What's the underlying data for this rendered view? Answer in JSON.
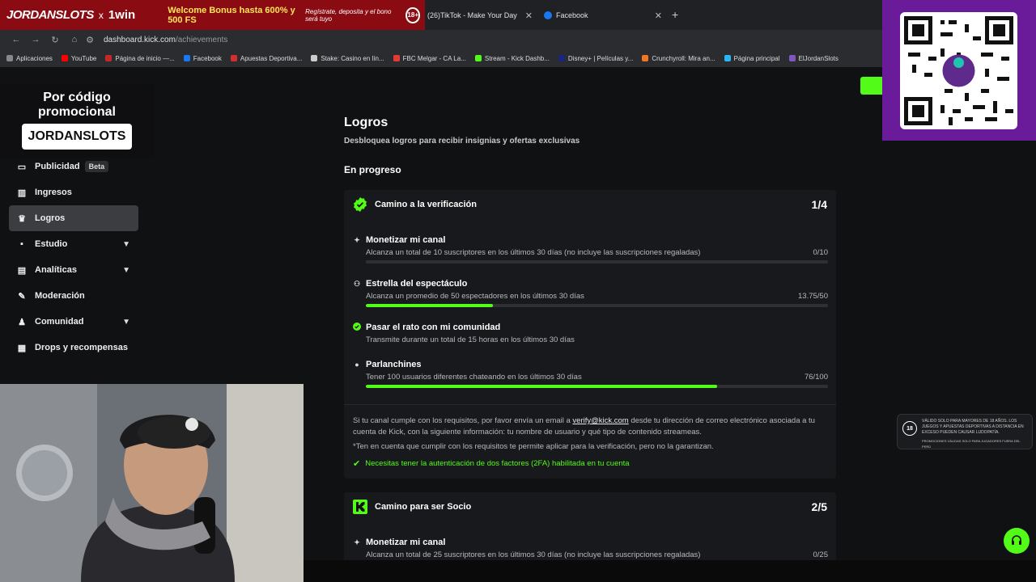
{
  "banner": {
    "brand": "JORDANSLOTS",
    "x": "x",
    "partner": "1win",
    "bonus": "Welcome Bonus hasta 600% y 500 FS",
    "register": "Regístrate, deposita y el bono será tuyo",
    "age": "18+"
  },
  "tabs": [
    {
      "label": "(26)TikTok - Make Your Day"
    },
    {
      "label": "Facebook"
    }
  ],
  "address": {
    "domain": "dashboard.kick.com",
    "path": "/achievements"
  },
  "bookmarks": [
    {
      "label": "Aplicaciones",
      "color": "#888888"
    },
    {
      "label": "YouTube",
      "color": "#ff0000"
    },
    {
      "label": "Página de inicio —...",
      "color": "#c62828"
    },
    {
      "label": "Facebook",
      "color": "#1877f2"
    },
    {
      "label": "Apuestas Deportiva...",
      "color": "#d32f2f"
    },
    {
      "label": "Stake: Casino en lín...",
      "color": "#cccccc"
    },
    {
      "label": "FBC Melgar - CA La...",
      "color": "#e53935"
    },
    {
      "label": "Stream - Kick Dashb...",
      "color": "#53fc18"
    },
    {
      "label": "Disney+ | Películas y...",
      "color": "#1a237e"
    },
    {
      "label": "Crunchyroll: Mira an...",
      "color": "#f47521"
    },
    {
      "label": "Página principal",
      "color": "#29b6f6"
    },
    {
      "label": "ElJordanSlots",
      "color": "#7e57c2"
    }
  ],
  "promo": {
    "line1": "Por código",
    "line2": "promocional",
    "code": "JORDANSLOTS"
  },
  "sidebar": {
    "items": [
      {
        "label": "Publicidad",
        "badge": "Beta"
      },
      {
        "label": "Ingresos"
      },
      {
        "label": "Logros"
      },
      {
        "label": "Estudio"
      },
      {
        "label": "Analíticas"
      },
      {
        "label": "Moderación"
      },
      {
        "label": "Comunidad"
      },
      {
        "label": "Drops y recompensas"
      }
    ]
  },
  "main": {
    "title": "Logros",
    "subtitle": "Desbloquea logros para recibir insignias y ofertas exclusivas",
    "section": "En progreso",
    "card1": {
      "title": "Camino a la verificación",
      "progress": "1/4",
      "tasks": [
        {
          "title": "Monetizar mi canal",
          "desc": "Alcanza un total de 10 suscriptores en los últimos 30 días (no incluye las suscripciones regaladas)",
          "value": "0/10",
          "fill": 0
        },
        {
          "title": "Estrella del espectáculo",
          "desc": "Alcanza un promedio de 50 espectadores en los últimos 30 días",
          "value": "13.75/50",
          "fill": 0.275
        },
        {
          "title": "Pasar el rato con mi comunidad",
          "desc": "Transmite durante un total de 15 horas en los últimos 30 días",
          "value": "",
          "fill": null
        },
        {
          "title": "Parlanchines",
          "desc": "Tener 100 usuarios diferentes chateando en los últimos 30 días",
          "value": "76/100",
          "fill": 0.76
        }
      ],
      "note_prefix": "Si tu canal cumple con los requisitos, por favor envía un email a",
      "note_email": "verify@kick.com",
      "note_suffix": "desde tu dirección de correo electrónico asociada a tu cuenta de Kick, con la siguiente información: tu nombre de usuario y qué tipo de contenido streameas.",
      "note2": "*Ten en cuenta que cumplir con los requisitos te permite aplicar para la verificación, pero no la garantizan.",
      "requirement": "Necesitas tener la autenticación de dos factores (2FA) habilitada en tu cuenta"
    },
    "card2": {
      "title": "Camino para ser Socio",
      "progress": "2/5",
      "tasks": [
        {
          "title": "Monetizar mi canal",
          "desc": "Alcanza un total de 25 suscriptores en los últimos 30 días (no incluye las suscripciones regaladas)",
          "value": "0/25"
        }
      ]
    }
  },
  "age_notice": {
    "age": "18",
    "text": "VÁLIDO SOLO PARA MAYORES DE 18 AÑOS. LOS JUEGOS Y APUESTAS DEPORTIVAS A DISTANCIA EN EXCESO PUEDEN CAUSAR LUDOPATÍA.",
    "footer": "PROMOCIONES VÁLIDAS SOLO PARA JUGADORES FUERA DEL PERÚ"
  },
  "colors": {
    "accent": "#53fc18",
    "qr_frame": "#6a1b9a"
  }
}
